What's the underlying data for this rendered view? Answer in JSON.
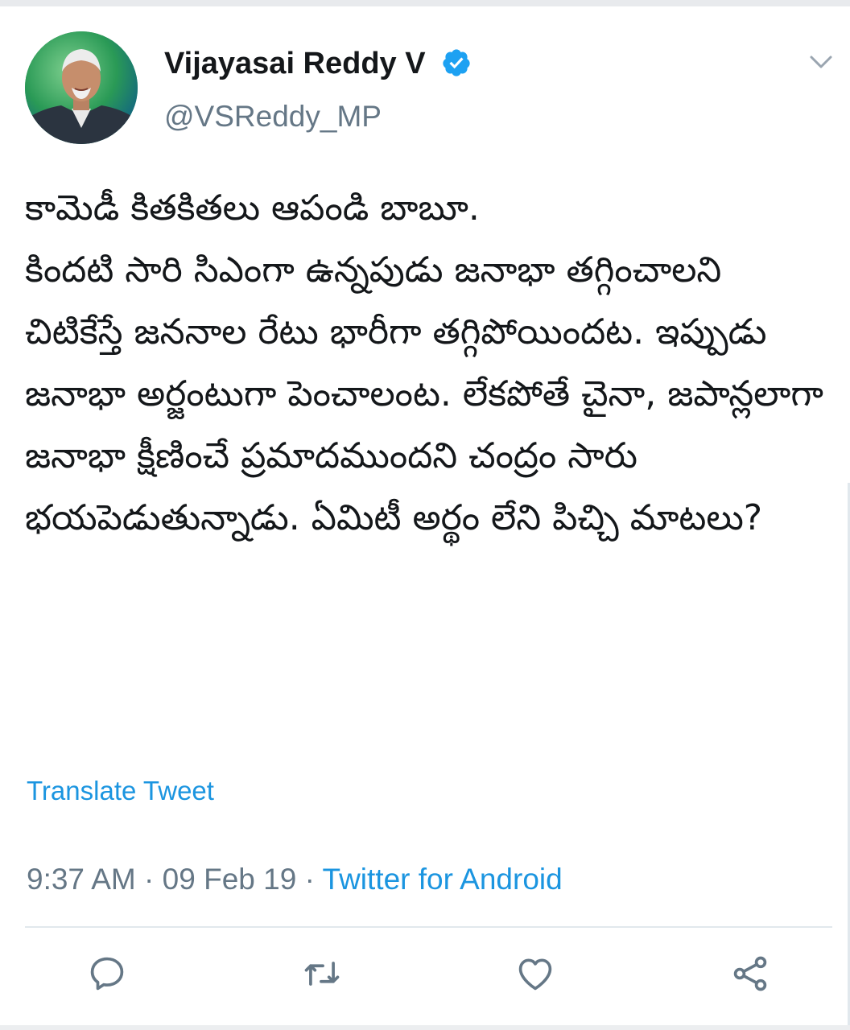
{
  "tweet": {
    "author": {
      "display_name": "Vijayasai Reddy V",
      "handle": "@VSReddy_MP",
      "verified": true,
      "avatar": "profile-photo"
    },
    "text": "కామెడీ కితకితలు ఆపండి బాబూ.\nకిందటి సారి సిఎంగా ఉన్నపుడు జనాభా తగ్గించాలని చిటికేస్తే జననాల రేటు భారీగా తగ్గిపోయిందట. ఇప్పుడు జనాభా అర్జంటుగా పెంచాలంట. లేకపోతే చైనా, జపాన్లలాగా జనాభా క్షీణించే ప్రమాదముందని చంద్రం సారు భయపెడుతున్నాడు. ఏమిటీ అర్థం లేని పిచ్చి మాటలు?",
    "translate_label": "Translate Tweet",
    "time": "9:37 AM",
    "separator": " · ",
    "date": "09 Feb 19",
    "source": "Twitter for Android",
    "actions": [
      {
        "name": "reply",
        "icon": "reply-icon"
      },
      {
        "name": "retweet",
        "icon": "retweet-icon"
      },
      {
        "name": "like",
        "icon": "heart-icon"
      },
      {
        "name": "share",
        "icon": "share-icon"
      }
    ]
  },
  "colors": {
    "link": "#1b95e0",
    "verified": "#1da1f2",
    "secondary_text": "#657786",
    "icon": "#657786",
    "text": "#14171a"
  }
}
